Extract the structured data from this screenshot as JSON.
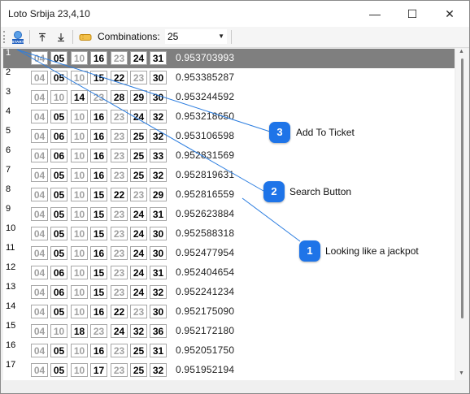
{
  "window": {
    "title": "Loto Srbija 23,4,10",
    "minimize_glyph": "—",
    "maximize_glyph": "☐",
    "close_glyph": "✕"
  },
  "toolbar": {
    "start_icon": "start-icon",
    "start_label": "START",
    "expand_icon": "arrow-up-bar-icon",
    "collapse_icon": "arrow-down-bar-icon",
    "ticket_icon": "ticket-icon",
    "combinations_label": "Combinations:",
    "combinations_value": "25"
  },
  "colors": {
    "selected_row": "#7f7f7f",
    "callout": "#1e74e8",
    "dim_number": "#a0a0a0",
    "callout_line": "#2b7de0"
  },
  "rows": [
    {
      "num": "1",
      "cells": [
        [
          "04",
          1
        ],
        [
          "05",
          0
        ],
        [
          "10",
          1
        ],
        [
          "16",
          0
        ],
        [
          "23",
          1
        ],
        [
          "24",
          0
        ],
        [
          "31",
          0
        ]
      ],
      "score": "0.953703993",
      "selected": true
    },
    {
      "num": "2",
      "cells": [
        [
          "04",
          1
        ],
        [
          "05",
          0
        ],
        [
          "10",
          1
        ],
        [
          "15",
          0
        ],
        [
          "22",
          0
        ],
        [
          "23",
          1
        ],
        [
          "30",
          0
        ]
      ],
      "score": "0.953385287"
    },
    {
      "num": "3",
      "cells": [
        [
          "04",
          1
        ],
        [
          "10",
          1
        ],
        [
          "14",
          0
        ],
        [
          "23",
          1
        ],
        [
          "28",
          0
        ],
        [
          "29",
          0
        ],
        [
          "30",
          0
        ]
      ],
      "score": "0.953244592"
    },
    {
      "num": "4",
      "cells": [
        [
          "04",
          1
        ],
        [
          "05",
          0
        ],
        [
          "10",
          1
        ],
        [
          "16",
          0
        ],
        [
          "23",
          1
        ],
        [
          "24",
          0
        ],
        [
          "32",
          0
        ]
      ],
      "score": "0.953218650"
    },
    {
      "num": "5",
      "cells": [
        [
          "04",
          1
        ],
        [
          "06",
          0
        ],
        [
          "10",
          1
        ],
        [
          "16",
          0
        ],
        [
          "23",
          1
        ],
        [
          "25",
          0
        ],
        [
          "32",
          0
        ]
      ],
      "score": "0.953106598"
    },
    {
      "num": "6",
      "cells": [
        [
          "04",
          1
        ],
        [
          "06",
          0
        ],
        [
          "10",
          1
        ],
        [
          "16",
          0
        ],
        [
          "23",
          1
        ],
        [
          "25",
          0
        ],
        [
          "33",
          0
        ]
      ],
      "score": "0.952831569"
    },
    {
      "num": "7",
      "cells": [
        [
          "04",
          1
        ],
        [
          "05",
          0
        ],
        [
          "10",
          1
        ],
        [
          "16",
          0
        ],
        [
          "23",
          1
        ],
        [
          "25",
          0
        ],
        [
          "32",
          0
        ]
      ],
      "score": "0.952819631"
    },
    {
      "num": "8",
      "cells": [
        [
          "04",
          1
        ],
        [
          "05",
          0
        ],
        [
          "10",
          1
        ],
        [
          "15",
          0
        ],
        [
          "22",
          0
        ],
        [
          "23",
          1
        ],
        [
          "29",
          0
        ]
      ],
      "score": "0.952816559"
    },
    {
      "num": "9",
      "cells": [
        [
          "04",
          1
        ],
        [
          "05",
          0
        ],
        [
          "10",
          1
        ],
        [
          "15",
          0
        ],
        [
          "23",
          1
        ],
        [
          "24",
          0
        ],
        [
          "31",
          0
        ]
      ],
      "score": "0.952623884"
    },
    {
      "num": "10",
      "cells": [
        [
          "04",
          1
        ],
        [
          "05",
          0
        ],
        [
          "10",
          1
        ],
        [
          "15",
          0
        ],
        [
          "23",
          1
        ],
        [
          "24",
          0
        ],
        [
          "30",
          0
        ]
      ],
      "score": "0.952588318"
    },
    {
      "num": "11",
      "cells": [
        [
          "04",
          1
        ],
        [
          "05",
          0
        ],
        [
          "10",
          1
        ],
        [
          "16",
          0
        ],
        [
          "23",
          1
        ],
        [
          "24",
          0
        ],
        [
          "30",
          0
        ]
      ],
      "score": "0.952477954"
    },
    {
      "num": "12",
      "cells": [
        [
          "04",
          1
        ],
        [
          "06",
          0
        ],
        [
          "10",
          1
        ],
        [
          "15",
          0
        ],
        [
          "23",
          1
        ],
        [
          "24",
          0
        ],
        [
          "31",
          0
        ]
      ],
      "score": "0.952404654"
    },
    {
      "num": "13",
      "cells": [
        [
          "04",
          1
        ],
        [
          "06",
          0
        ],
        [
          "10",
          1
        ],
        [
          "15",
          0
        ],
        [
          "23",
          1
        ],
        [
          "24",
          0
        ],
        [
          "32",
          0
        ]
      ],
      "score": "0.952241234"
    },
    {
      "num": "14",
      "cells": [
        [
          "04",
          1
        ],
        [
          "05",
          0
        ],
        [
          "10",
          1
        ],
        [
          "16",
          0
        ],
        [
          "22",
          0
        ],
        [
          "23",
          1
        ],
        [
          "30",
          0
        ]
      ],
      "score": "0.952175090"
    },
    {
      "num": "15",
      "cells": [
        [
          "04",
          1
        ],
        [
          "10",
          1
        ],
        [
          "18",
          0
        ],
        [
          "23",
          1
        ],
        [
          "24",
          0
        ],
        [
          "32",
          0
        ],
        [
          "36",
          0
        ]
      ],
      "score": "0.952172180"
    },
    {
      "num": "16",
      "cells": [
        [
          "04",
          1
        ],
        [
          "05",
          0
        ],
        [
          "10",
          1
        ],
        [
          "16",
          0
        ],
        [
          "23",
          1
        ],
        [
          "25",
          0
        ],
        [
          "31",
          0
        ]
      ],
      "score": "0.952051750"
    },
    {
      "num": "17",
      "cells": [
        [
          "04",
          1
        ],
        [
          "05",
          0
        ],
        [
          "10",
          1
        ],
        [
          "17",
          0
        ],
        [
          "23",
          1
        ],
        [
          "25",
          0
        ],
        [
          "32",
          0
        ]
      ],
      "score": "0.951952194"
    }
  ],
  "callouts": [
    {
      "number": "3",
      "text": "Add To Ticket"
    },
    {
      "number": "2",
      "text": "Search Button"
    },
    {
      "number": "1",
      "text": "Looking like a jackpot"
    }
  ]
}
